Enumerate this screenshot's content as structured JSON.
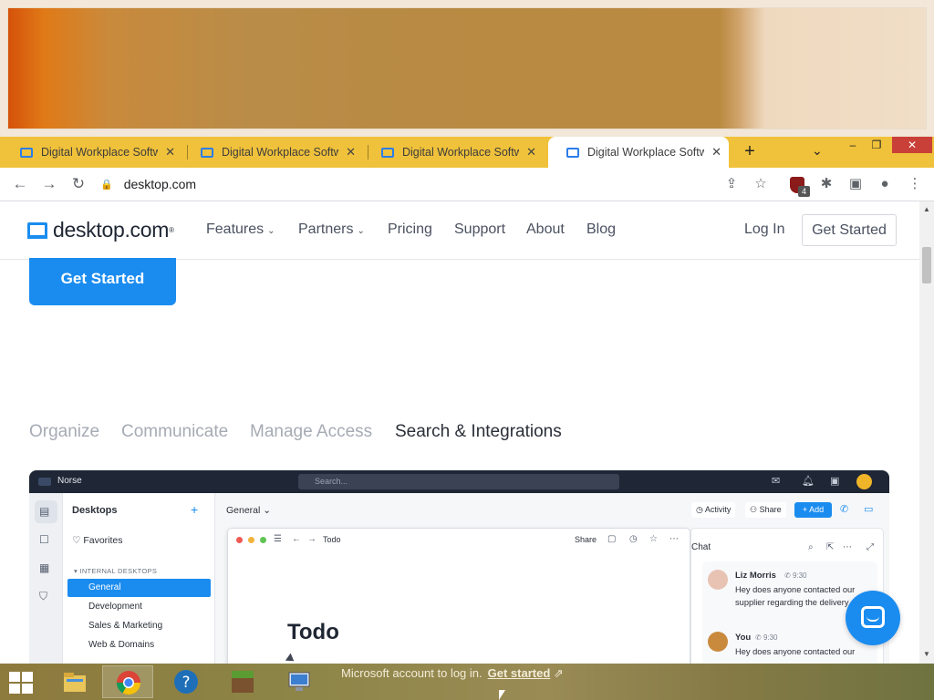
{
  "browser": {
    "tabs": [
      {
        "title": "Digital Workplace Software",
        "close": "✕",
        "active": false
      },
      {
        "title": "Digital Workplace Software",
        "close": "✕",
        "active": false
      },
      {
        "title": "Digital Workplace Software",
        "close": "✕",
        "active": false
      },
      {
        "title": "Digital Workplace Software",
        "close": "✕",
        "active": true
      }
    ],
    "new_tab": "+",
    "tab_search": "⌄",
    "window_buttons": {
      "minimize": "–",
      "maximize": "❐",
      "close": "✕"
    },
    "url": "desktop.com",
    "extension_badge": "4",
    "colors": {
      "tabstrip": "#f0c13a",
      "close_button": "#c94038"
    }
  },
  "site": {
    "logo_text": "desktop.com",
    "logo_reg": "®",
    "nav": [
      "Features",
      "Partners",
      "Pricing",
      "Support",
      "About",
      "Blog"
    ],
    "login": "Log In",
    "get_started_header": "Get Started",
    "cta": "Get Started",
    "feature_tabs": [
      "Organize",
      "Communicate",
      "Manage Access",
      "Search & Integrations"
    ],
    "active_feature_tab": "Search & Integrations",
    "accent_color": "#1a8cf0"
  },
  "mockup": {
    "workspace": "Norse",
    "search_placeholder": "Search...",
    "sidebar": {
      "header": "Desktops",
      "favorites": "Favorites",
      "section": "INTERNAL DESKTOPS",
      "items": [
        "General",
        "Development",
        "Sales & Marketing",
        "Web & Domains"
      ],
      "active": "General"
    },
    "main": {
      "desktop_name": "General",
      "activity": "Activity",
      "share": "Share",
      "add": "+ Add"
    },
    "todo": {
      "title": "Todo",
      "share": "Share",
      "heading": "Todo"
    },
    "chat": {
      "title": "Chat",
      "messages": [
        {
          "name": "Liz Morris",
          "time": "9:30",
          "text": "Hey does anyone contacted our supplier regarding the delivery date?"
        },
        {
          "name": "You",
          "time": "9:30",
          "text": "Hey does anyone contacted our"
        }
      ]
    }
  },
  "taskbar": {
    "notification": "Microsoft account to log in.",
    "notification_link": "Get started"
  }
}
